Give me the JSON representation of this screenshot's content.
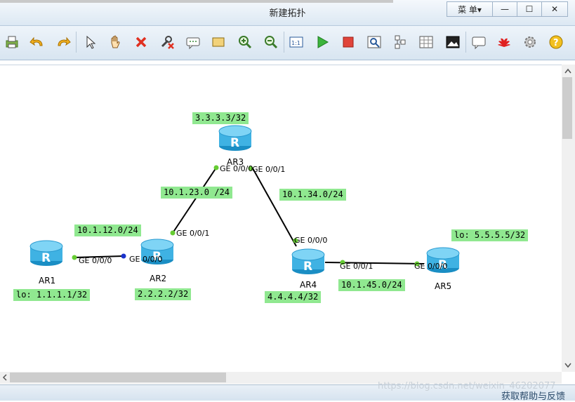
{
  "window": {
    "title": "新建拓扑",
    "menu_label": "菜 单▾",
    "minimize": "—",
    "maximize": "☐",
    "close": "✕"
  },
  "toolbar": {
    "icons": [
      "print-icon",
      "undo-icon",
      "redo-icon",
      "select-pointer-icon",
      "pan-hand-icon",
      "delete-icon",
      "delete-link-icon",
      "text-note-icon",
      "rectangle-icon",
      "zoom-in-icon",
      "zoom-out-icon",
      "fit-topology-icon",
      "start-device-icon",
      "stop-device-icon",
      "capture-icon",
      "topology-icon",
      "grid-icon",
      "snapshot-icon",
      "chat-icon",
      "huawei-logo-icon",
      "settings-icon",
      "help-icon"
    ]
  },
  "topology": {
    "routers": [
      {
        "name": "AR1",
        "mark": "R"
      },
      {
        "name": "AR2",
        "mark": "R"
      },
      {
        "name": "AR3",
        "mark": "R"
      },
      {
        "name": "AR4",
        "mark": "R"
      },
      {
        "name": "AR5",
        "mark": "R"
      }
    ],
    "labels": {
      "ar1_lo": "lo: 1.1.1.1/32",
      "ar2_lo": "2.2.2.2/32",
      "ar3_lo": "3.3.3.3/32",
      "ar4_lo": "4.4.4.4/32",
      "ar5_lo": "lo: 5.5.5.5/32",
      "net_12": "10.1.12.0/24",
      "net_23": "10.1.23.0 /24",
      "net_34": "10.1.34.0/24",
      "net_45": "10.1.45.0/24"
    },
    "ports": {
      "ar1_g000": "GE 0/0/0",
      "ar2_g000": "GE 0/0/0",
      "ar2_g001": "GE 0/0/1",
      "ar3_g000": "GE 0/0/0",
      "ar3_g001": "GE 0/0/1",
      "ar4_g000": "GE 0/0/0",
      "ar4_g001": "GE 0/0/1",
      "ar5_g000": "GE 0/0/0"
    },
    "colors": {
      "link": "#000000",
      "port_dot": "#66cc33",
      "port_dot_selected": "#1a33cc",
      "label_bg": "#90e890",
      "router_body": "#4fc3ee"
    }
  },
  "status": {
    "help_text": "获取帮助与反馈",
    "watermark": "https://blog.csdn.net/weixin_46202077"
  }
}
